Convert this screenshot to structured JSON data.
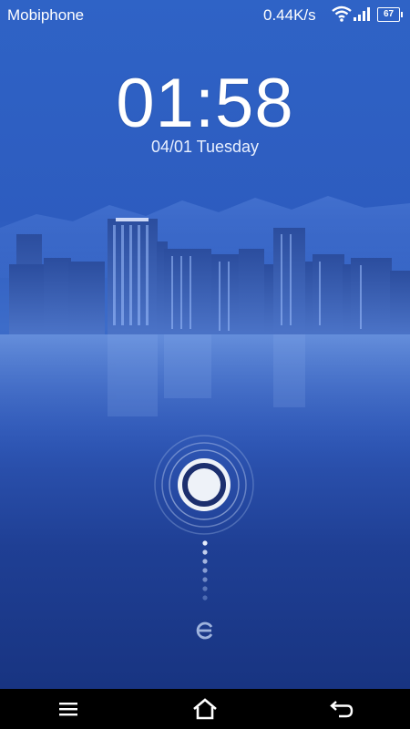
{
  "status": {
    "carrier": "Mobiphone",
    "speed": "0.44K/s",
    "battery": "67",
    "icons": [
      "wifi-icon",
      "signal-icon",
      "battery-icon"
    ]
  },
  "lockscreen": {
    "time": "01:58",
    "date": "04/01 Tuesday"
  },
  "navbar": {
    "icons": [
      "menu-icon",
      "home-icon",
      "back-icon"
    ]
  },
  "colors": {
    "background_top": "#2f63c6",
    "background_bottom": "#16317c",
    "navbar": "#000000",
    "text": "#ffffff"
  }
}
